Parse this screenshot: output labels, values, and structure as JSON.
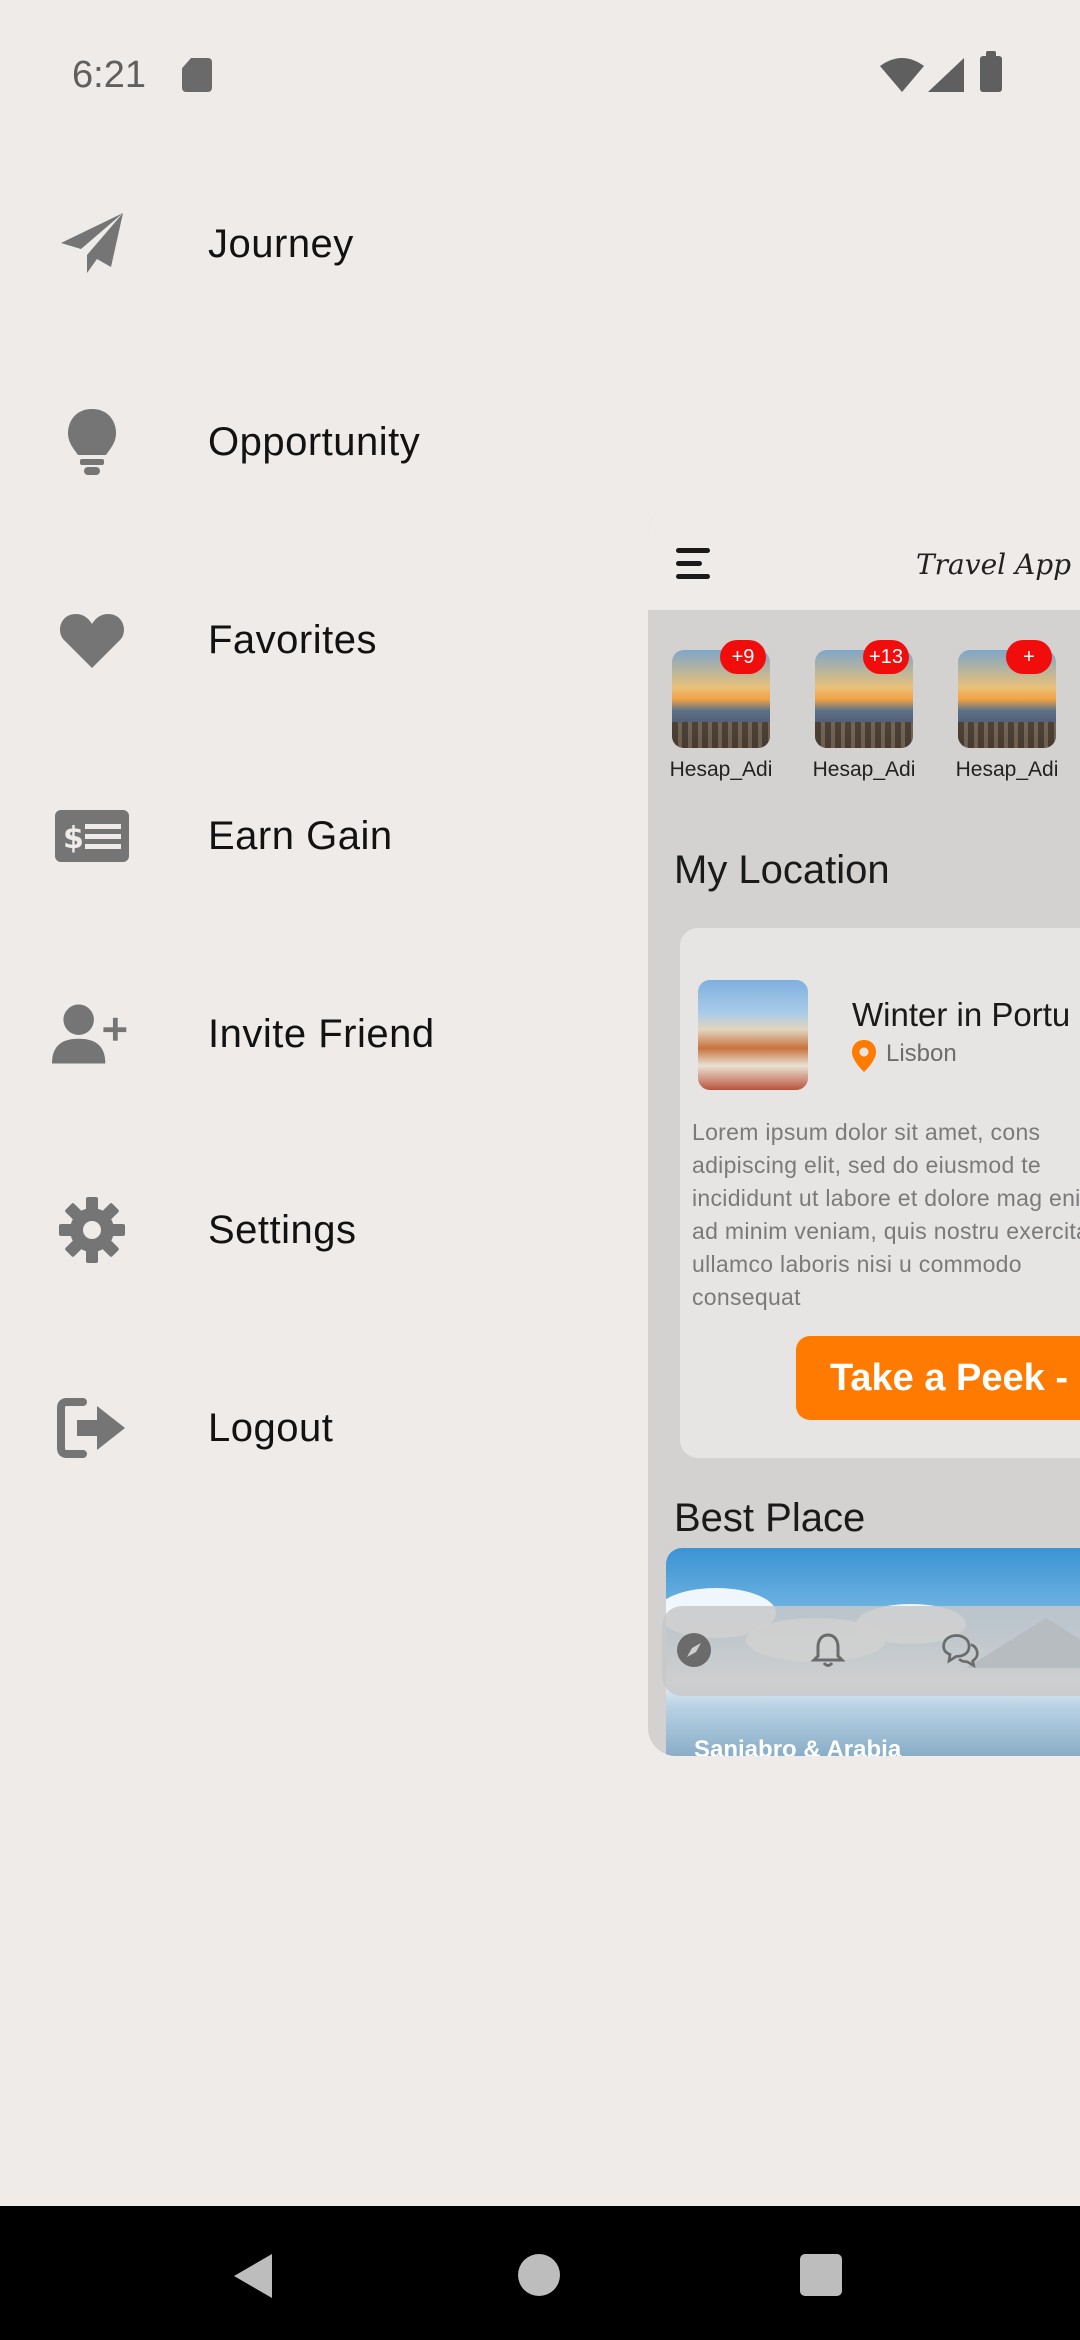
{
  "status_bar": {
    "time": "6:21"
  },
  "drawer": {
    "items": [
      {
        "label": "Journey",
        "icon": "paper-plane-icon"
      },
      {
        "label": "Opportunity",
        "icon": "lightbulb-icon"
      },
      {
        "label": "Favorites",
        "icon": "heart-icon"
      },
      {
        "label": "Earn Gain",
        "icon": "money-bill-icon"
      },
      {
        "label": "Invite Friend",
        "icon": "user-plus-icon"
      },
      {
        "label": "Settings",
        "icon": "gear-icon"
      },
      {
        "label": "Logout",
        "icon": "logout-icon"
      }
    ]
  },
  "preview": {
    "app_title": "Travel App",
    "stories": [
      {
        "name": "Hesap_Adi",
        "badge": "+9"
      },
      {
        "name": "Hesap_Adi",
        "badge": "+13"
      },
      {
        "name": "Hesap_Adi",
        "badge": "+"
      }
    ],
    "my_location_title": "My Location",
    "location_card": {
      "title": "Winter in Portu",
      "city": "Lisbon",
      "description": "Lorem ipsum dolor sit amet, cons adipiscing elit, sed do eiusmod te incididunt ut labore et dolore mag enim ad minim veniam, quis nostru exercitation ullamco laboris nisi u commodo consequat",
      "button_label": "Take a Peek -"
    },
    "best_place_title": "Best Place",
    "best_place_caption": "Sanjabro & Arabia",
    "nav_icons": [
      "compass-icon",
      "bell-icon",
      "chat-icon"
    ]
  },
  "colors": {
    "background": "#EEEBE9",
    "accent": "#FF7A00",
    "badge": "#F20D0D",
    "icon": "#757575"
  }
}
